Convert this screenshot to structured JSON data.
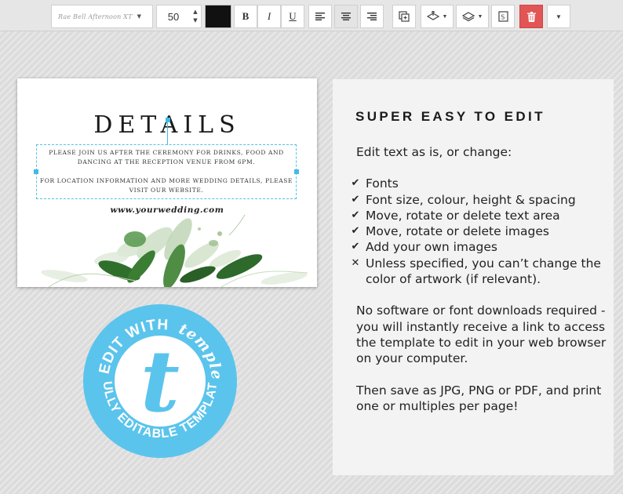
{
  "toolbar": {
    "font_name": "Rae Bell Afternoon XT",
    "font_size": "50",
    "text_color": "#111111",
    "bold_label": "B",
    "italic_label": "I",
    "underline_label": "U"
  },
  "card": {
    "title": "DETAILS",
    "paragraph_1": "PLEASE JOIN US AFTER THE CEREMONY FOR DRINKS, FOOD AND DANCING AT THE RECEPTION VENUE FROM 6PM.",
    "paragraph_2": "FOR LOCATION INFORMATION AND MORE WEDDING DETAILS, PLEASE VISIT OUR WEBSITE.",
    "url": "www.yourwedding.com"
  },
  "badge": {
    "top_text": "EDIT WITH",
    "brand": "templett",
    "bottom_text": "FULLY EDITABLE TEMPLATE",
    "letter": "t",
    "color": "#5bc4ec"
  },
  "panel": {
    "heading": "SUPER EASY TO EDIT",
    "intro": "Edit text as is, or change:",
    "features": [
      {
        "mark": "✔",
        "text": "Fonts"
      },
      {
        "mark": "✔",
        "text": "Font size, colour, height & spacing"
      },
      {
        "mark": "✔",
        "text": "Move, rotate or delete text area"
      },
      {
        "mark": "✔",
        "text": "Move, rotate or delete images"
      },
      {
        "mark": "✔",
        "text": "Add your own images"
      },
      {
        "mark": "✕",
        "text": "Unless specified, you can’t change the color of artwork (if relevant)."
      }
    ],
    "paragraph_2": "No software or font downloads required - you will instantly receive a link to access the template to edit in your web browser on your computer.",
    "paragraph_3": "Then save as JPG, PNG or PDF, and print one or multiples per page!"
  }
}
